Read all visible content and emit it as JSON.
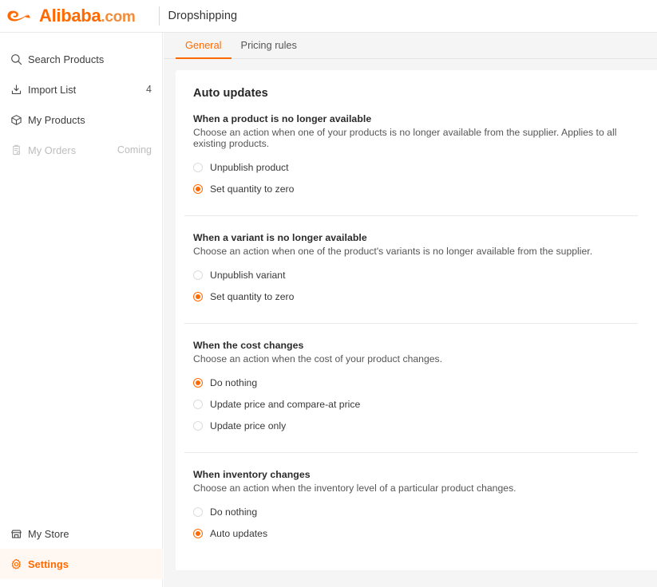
{
  "header": {
    "logo_text": "Alibaba",
    "logo_suffix": ".com",
    "logo_icon": "alibaba-swirl-icon",
    "app_title": "Dropshipping"
  },
  "sidebar": {
    "items": [
      {
        "label": "Search Products",
        "icon": "search-icon",
        "meta": "",
        "state": "normal"
      },
      {
        "label": "Import List",
        "icon": "import-download-icon",
        "meta": "4",
        "state": "normal"
      },
      {
        "label": "My Products",
        "icon": "box-cube-icon",
        "meta": "",
        "state": "normal"
      },
      {
        "label": "My Orders",
        "icon": "clipboard-orders-icon",
        "meta": "Coming",
        "state": "disabled"
      }
    ],
    "bottom_items": [
      {
        "label": "My Store",
        "icon": "storefront-icon",
        "state": "normal"
      },
      {
        "label": "Settings",
        "icon": "gear-icon",
        "state": "active"
      }
    ]
  },
  "tabs": [
    {
      "label": "General",
      "active": true
    },
    {
      "label": "Pricing rules",
      "active": false
    }
  ],
  "main": {
    "title": "Auto updates",
    "sections": [
      {
        "title": "When a product is no longer available",
        "description": "Choose an action when one of your products is no longer available from the supplier. Applies to all existing products.",
        "options": [
          {
            "label": "Unpublish product",
            "selected": false
          },
          {
            "label": "Set quantity to zero",
            "selected": true
          }
        ]
      },
      {
        "title": "When a variant is no longer available",
        "description": "Choose an action when one of the product's variants is no longer available from the supplier.",
        "options": [
          {
            "label": "Unpublish variant",
            "selected": false
          },
          {
            "label": "Set quantity to zero",
            "selected": true
          }
        ]
      },
      {
        "title": "When the cost changes",
        "description": "Choose an action when the cost of your product changes.",
        "options": [
          {
            "label": "Do nothing",
            "selected": true
          },
          {
            "label": "Update price and compare-at price",
            "selected": false
          },
          {
            "label": "Update price only",
            "selected": false
          }
        ]
      },
      {
        "title": "When inventory changes",
        "description": "Choose an action when the inventory level of a particular product changes.",
        "options": [
          {
            "label": "Do nothing",
            "selected": false
          },
          {
            "label": "Auto updates",
            "selected": true
          }
        ]
      }
    ]
  },
  "colors": {
    "accent": "#ff6a00",
    "page_bg": "#f5f5f5",
    "card_bg": "#ffffff",
    "active_nav_bg": "#fff7f2"
  }
}
